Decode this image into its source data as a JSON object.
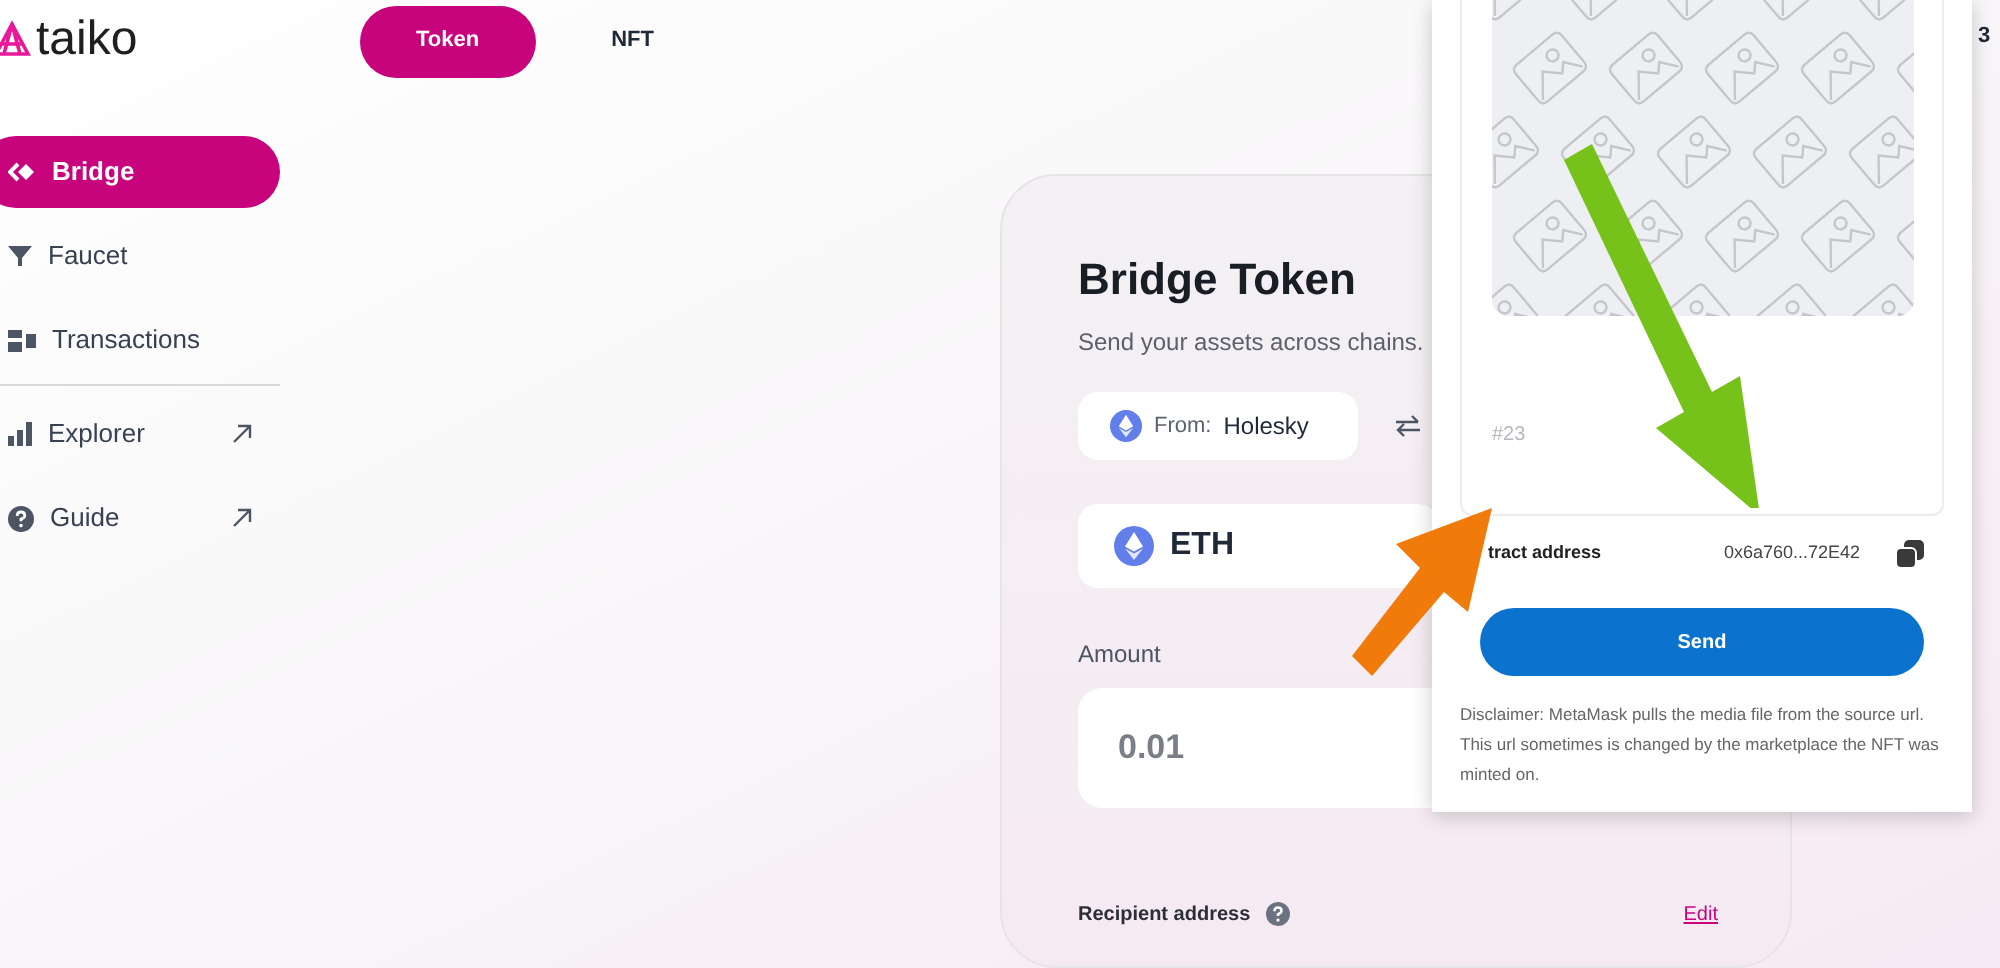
{
  "logo": {
    "text": "taiko"
  },
  "tabs": [
    {
      "label": "Token",
      "selected": true
    },
    {
      "label": "NFT",
      "selected": false
    }
  ],
  "sidebar": {
    "sections": [
      [
        {
          "label": "Bridge",
          "kind": "bridge",
          "selected": true,
          "external": false
        },
        {
          "label": "Faucet",
          "kind": "faucet",
          "selected": false,
          "external": false
        },
        {
          "label": "Transactions",
          "kind": "transactions",
          "selected": false,
          "external": false
        }
      ],
      [
        {
          "label": "Explorer",
          "kind": "explorer",
          "selected": false,
          "external": true
        },
        {
          "label": "Guide",
          "kind": "guide",
          "selected": false,
          "external": true
        }
      ]
    ]
  },
  "card": {
    "title": "Bridge Token",
    "subtitle": "Send your assets across chains.",
    "from": {
      "label": "From:",
      "chain": "Holesky"
    },
    "token": "ETH",
    "amount": {
      "label": "Amount",
      "value": "0.01"
    },
    "recipient": {
      "label": "Recipient address",
      "action": "Edit"
    }
  },
  "header_fragment": "3",
  "popup": {
    "nft_id": "#23",
    "contract": {
      "label": "tract address",
      "value": "0x6a760...72E42"
    },
    "button": "Send",
    "disclaimer": "Disclaimer: MetaMask pulls the media file from the source url. This url sometimes is changed by the marketplace the NFT was minted on."
  }
}
